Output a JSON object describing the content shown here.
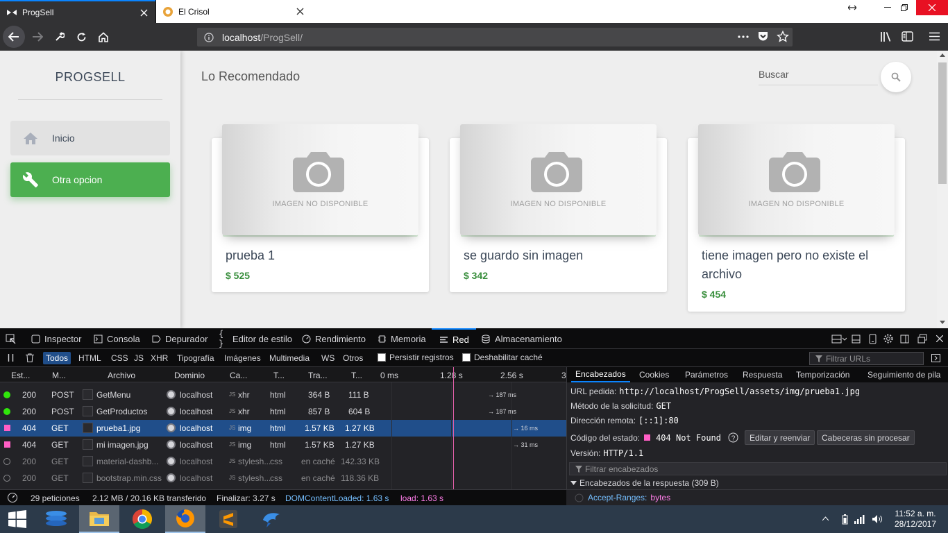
{
  "browser": {
    "tabs": [
      {
        "title": "ProgSell",
        "active": true
      },
      {
        "title": "El Crisol",
        "active": false
      }
    ],
    "url_host": "localhost",
    "url_path": "/ProgSell/"
  },
  "page": {
    "brand": "PROGSELL",
    "nav": [
      {
        "label": "Inicio",
        "icon": "home-icon"
      },
      {
        "label": "Otra opcion",
        "icon": "wrench-icon",
        "active": true
      }
    ],
    "title": "Lo Recomendado",
    "search_placeholder": "Buscar",
    "no_image_text": "IMAGEN NO DISPONIBLE",
    "products": [
      {
        "name": "prueba 1",
        "price": "$ 525"
      },
      {
        "name": "se guardo sin imagen",
        "price": "$ 342"
      },
      {
        "name": "tiene imagen pero no existe el archivo",
        "price": "$ 454"
      }
    ],
    "accent_color": "#4caf50"
  },
  "devtools": {
    "tabs": [
      "Inspector",
      "Consola",
      "Depurador",
      "Editor de estilo",
      "Rendimiento",
      "Memoria",
      "Red",
      "Almacenamiento"
    ],
    "active_tab": "Red",
    "filters": [
      "Todos",
      "HTML",
      "CSS",
      "JS",
      "XHR",
      "Tipografía",
      "Imágenes",
      "Multimedia",
      "WS",
      "Otros"
    ],
    "persist_label": "Persistir registros",
    "disable_cache_label": "Deshabilitar caché",
    "filter_urls_placeholder": "Filtrar URLs",
    "columns": [
      "Est...",
      "M...",
      "Archivo",
      "Dominio",
      "Ca...",
      "T...",
      "Tra...",
      "T..."
    ],
    "timeline_ticks": [
      "0 ms",
      "1.28 s",
      "2.56 s",
      "3"
    ],
    "requests": [
      {
        "status": "200",
        "method": "POST",
        "file": "GetMenu",
        "domain": "localhost",
        "cause": "xhr",
        "type": "html",
        "transferred": "364 B",
        "size": "111 B",
        "timing": "→ 187 ms",
        "status_color": "#30e60b"
      },
      {
        "status": "200",
        "method": "POST",
        "file": "GetProductos",
        "domain": "localhost",
        "cause": "xhr",
        "type": "html",
        "transferred": "857 B",
        "size": "604 B",
        "timing": "→ 187 ms",
        "status_color": "#30e60b"
      },
      {
        "status": "404",
        "method": "GET",
        "file": "prueba1.jpg",
        "domain": "localhost",
        "cause": "img",
        "type": "html",
        "transferred": "1.57 KB",
        "size": "1.27 KB",
        "timing": "→ 16 ms",
        "status_color": "#ff5ec5",
        "selected": true
      },
      {
        "status": "404",
        "method": "GET",
        "file": "mi imagen.jpg",
        "domain": "localhost",
        "cause": "img",
        "type": "html",
        "transferred": "1.57 KB",
        "size": "1.27 KB",
        "timing": "→ 31 ms",
        "status_color": "#ff5ec5"
      },
      {
        "status": "200",
        "method": "GET",
        "file": "material-dashb...",
        "domain": "localhost",
        "cause": "stylesh...",
        "type": "css",
        "transferred": "en caché",
        "size": "142.33 KB",
        "timing": "",
        "status_color": "#8a8a8d"
      },
      {
        "status": "200",
        "method": "GET",
        "file": "bootstrap.min.css",
        "domain": "localhost",
        "cause": "stylesh...",
        "type": "css",
        "transferred": "en caché",
        "size": "118.36 KB",
        "timing": "",
        "status_color": "#8a8a8d"
      }
    ],
    "detail_tabs": [
      "Encabezados",
      "Cookies",
      "Parámetros",
      "Respuesta",
      "Temporización",
      "Seguimiento de pila"
    ],
    "detail": {
      "url_label": "URL pedida:",
      "url_value": "http://localhost/ProgSell/assets/img/prueba1.jpg",
      "method_label": "Método de la solicitud:",
      "method_value": "GET",
      "remote_label": "Dirección remota:",
      "remote_value": "[::1]:80",
      "status_label": "Código del estado:",
      "status_value": "404 Not Found",
      "edit_btn": "Editar y reenviar",
      "raw_btn": "Cabeceras sin procesar",
      "version_label": "Versión:",
      "version_value": "HTTP/1.1",
      "filter_headers": "Filtrar encabezados",
      "response_headers": "Encabezados de la respuesta (309 B)",
      "accept_ranges_key": "Accept-Ranges:",
      "accept_ranges_value": "bytes"
    },
    "status": {
      "requests": "29 peticiones",
      "transferred": "2.12 MB / 20.16 KB transferido",
      "finish": "Finalizar: 3.27 s",
      "dcl": "DOMContentLoaded: 1.63 s",
      "load": "load: 1.63 s"
    }
  },
  "taskbar": {
    "time": "11:52 a. m.",
    "date": "28/12/2017",
    "apps": [
      "start-button",
      "taskview-icon",
      "file-explorer-icon",
      "chrome-icon",
      "firefox-icon",
      "sublime-text-icon",
      "app-icon"
    ]
  }
}
